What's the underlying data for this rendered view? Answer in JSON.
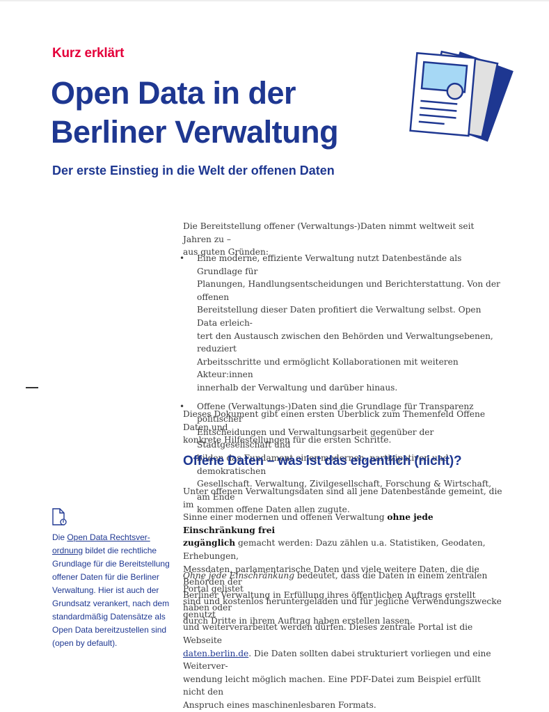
{
  "header": {
    "kicker": "Kurz erklärt",
    "title_line1": "Open Data in der",
    "title_line2": "Berliner Verwaltung",
    "subtitle": "Der erste Einstieg in die Welt der offenen Daten"
  },
  "illustration": {
    "icon": "document-stack-icon"
  },
  "intro": {
    "line1": "Die Bereitstellung offener (Verwaltungs-)Daten nimmt weltweit seit Jahren zu –",
    "line2": "aus guten Gründen:"
  },
  "bullets": [
    {
      "marker": "•",
      "lines": [
        "Eine moderne, effiziente Verwaltung nutzt Datenbestände als Grundlage für",
        "Planungen, Handlungsentscheidungen und Berichterstattung. Von der offenen",
        "Bereitstellung dieser Daten profitiert die Verwaltung selbst. Open Data erleich-",
        "tert den Austausch zwischen den Behörden und Verwaltungsebenen, reduziert",
        "Arbeitsschritte und ermöglicht Kollaborationen mit weiteren Akteur:innen",
        "innerhalb der Verwaltung und darüber hinaus."
      ]
    },
    {
      "marker": "•",
      "lines": [
        "Offene (Verwaltungs-)Daten sind die Grundlage für Transparenz politischer",
        "Entscheidungen und Verwaltungsarbeit gegenüber der Stadtgesellschaft und",
        "bilden das Fundament einer modernen, partizipativen und demokratischen",
        "Gesellschaft. Verwaltung, Zivilgesellschaft, Forschung & Wirtschaft, am Ende",
        "kommen offene Daten allen zugute."
      ]
    }
  ],
  "closing": {
    "line1": "Dieses Dokument gibt einen ersten Überblick zum Themenfeld Offene Daten und",
    "line2": "konkrete Hilfestellungen für die ersten Schritte."
  },
  "section": {
    "heading": "Offene Daten – was ist das eigentlich (nicht)?",
    "para1": {
      "l1": "Unter offenen Verwaltungsdaten sind all jene Datenbestände gemeint, die im",
      "l2_pre": "Sinne einer modernen und offenen Verwaltung ",
      "l2_bold": "ohne jede Einschränkung frei",
      "l3_bold": "zugänglich",
      "l3_post": " gemacht werden: Dazu zählen u.a. Statistiken, Geodaten, Erhebungen,",
      "l4": "Messdaten, parlamentarische Daten und viele weitere Daten, die die Behörden der",
      "l5": "Berliner Verwaltung in Erfüllung ihres öffentlichen Auftrags erstellt haben oder",
      "l6": "durch Dritte in ihrem Auftrag haben erstellen lassen."
    },
    "para2": {
      "l1_italic": "Ohne jede Einschränkung",
      "l1_post": " bedeutet, dass die Daten in einem zentralen Portal gelistet",
      "l2": "sind und kostenlos heruntergeladen und für jegliche Verwendungszwecke genutzt",
      "l3": "und weiterverarbeitet werden dürfen. Dieses zentrale Portal ist die Webseite",
      "l4_link": "daten.berlin.de",
      "l4_post": ". Die Daten sollten dabei strukturiert vorliegen und eine Weiterver-",
      "l5": "wendung leicht möglich machen. Eine PDF-Datei zum Beispiel erfüllt nicht den",
      "l6": "Anspruch eines maschinenlesbaren Formats."
    }
  },
  "sidebar": {
    "icon": "document-link-icon",
    "l1_pre": "Die ",
    "l1_link": "Open Data Rechtsver-",
    "l2_link": "ordnung",
    "l2_post": " bildet die rechtliche",
    "l3": "Grundlage für die Bereitstellung",
    "l4": "offener Daten für die Berliner",
    "l5": "Verwaltung. Hier ist auch der",
    "l6": "Grundsatz verankert, nach dem",
    "l7": "standardmäßig Datensätze als",
    "l8": "Open Data bereitzustellen sind",
    "l9": "(open by default)."
  }
}
